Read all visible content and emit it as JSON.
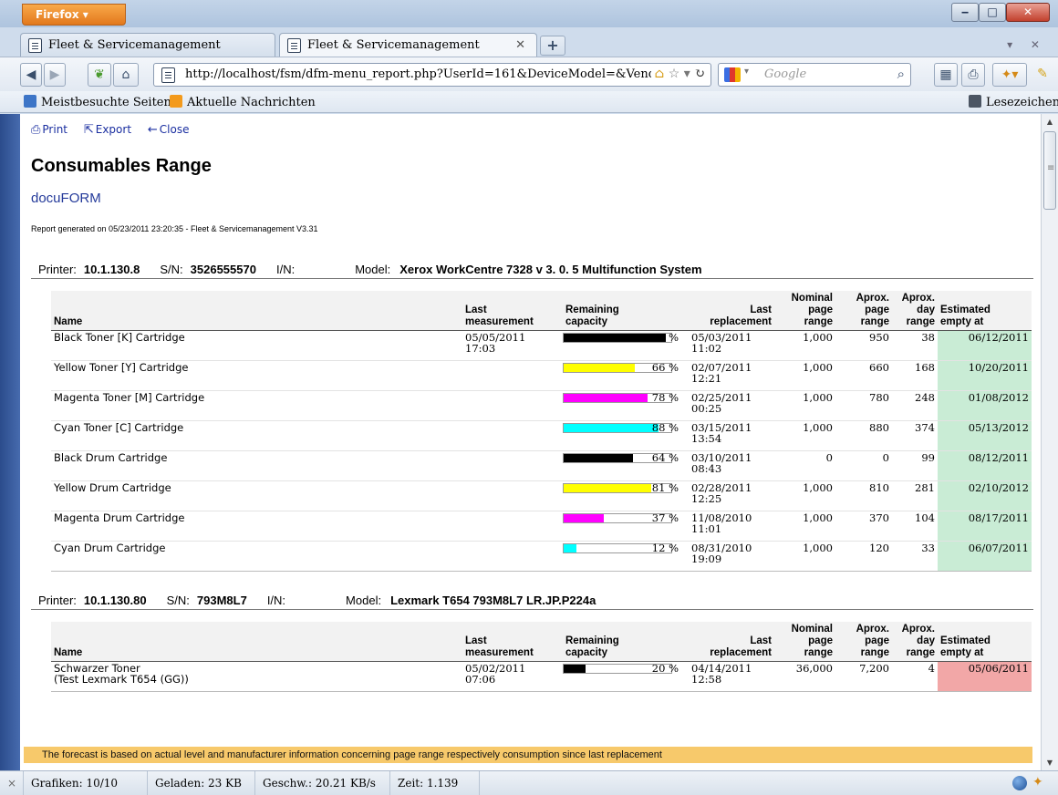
{
  "browser": {
    "app_button": "Firefox ▾",
    "tabs": [
      {
        "title": "Fleet & Servicemanagement"
      },
      {
        "title": "Fleet & Servicemanagement"
      }
    ],
    "url": "http://localhost/fsm/dfm-menu_report.php?UserId=161&DeviceModel=&Vendo",
    "search_placeholder": "Google",
    "bookmarks": [
      "Meistbesuchte Seiten",
      "Aktuelle Nachrichten"
    ],
    "bookmarks_right": "Lesezeichen"
  },
  "report": {
    "actions": {
      "print": "Print",
      "export": "Export",
      "close": "Close"
    },
    "title": "Consumables Range",
    "org": "docuFORM",
    "generated": "Report generated on 05/23/2011 23:20:35 - Fleet & Servicemanagement V3.31",
    "labels": {
      "printer": "Printer:",
      "sn": "S/N:",
      "in": "I/N:",
      "model": "Model:"
    },
    "columns": {
      "name": "Name",
      "last_measurement": [
        "Last",
        "measurement"
      ],
      "remaining": [
        "Remaining",
        "capacity"
      ],
      "last_replacement": [
        "Last",
        "replacement"
      ],
      "nominal": [
        "Nominal",
        "page",
        "range"
      ],
      "aprox_page": [
        "Aprox.",
        "page",
        "range"
      ],
      "aprox_day": [
        "Aprox.",
        "day",
        "range"
      ],
      "estimated": [
        "Estimated",
        "empty at"
      ]
    },
    "printers": [
      {
        "ip": "10.1.130.8",
        "sn": "3526555570",
        "in": "",
        "model": "Xerox WorkCentre 7328 v 3. 0. 5 Multifunction System",
        "items": [
          {
            "name": "Black Toner [K] Cartridge",
            "name2": "",
            "meas_date": "05/05/2011",
            "meas_time": "17:03",
            "pct": 95,
            "pct_label": "95 %",
            "color": "#000000",
            "rep_date": "05/03/2011",
            "rep_time": "11:02",
            "nominal": "1,000",
            "aprox_page": "950",
            "aprox_day": "38",
            "estimated": "06/12/2011",
            "est_bg": "#c9ecd5"
          },
          {
            "name": "Yellow Toner [Y] Cartridge",
            "name2": "",
            "meas_date": "",
            "meas_time": "",
            "pct": 66,
            "pct_label": "66 %",
            "color": "#ffff00",
            "rep_date": "02/07/2011",
            "rep_time": "12:21",
            "nominal": "1,000",
            "aprox_page": "660",
            "aprox_day": "168",
            "estimated": "10/20/2011",
            "est_bg": "#c9ecd5"
          },
          {
            "name": "Magenta Toner [M] Cartridge",
            "name2": "",
            "meas_date": "",
            "meas_time": "",
            "pct": 78,
            "pct_label": "78 %",
            "color": "#ff00ff",
            "rep_date": "02/25/2011",
            "rep_time": "00:25",
            "nominal": "1,000",
            "aprox_page": "780",
            "aprox_day": "248",
            "estimated": "01/08/2012",
            "est_bg": "#c9ecd5"
          },
          {
            "name": "Cyan Toner [C] Cartridge",
            "name2": "",
            "meas_date": "",
            "meas_time": "",
            "pct": 88,
            "pct_label": "88 %",
            "color": "#00ffff",
            "rep_date": "03/15/2011",
            "rep_time": "13:54",
            "nominal": "1,000",
            "aprox_page": "880",
            "aprox_day": "374",
            "estimated": "05/13/2012",
            "est_bg": "#c9ecd5"
          },
          {
            "name": "Black Drum Cartridge",
            "name2": "",
            "meas_date": "",
            "meas_time": "",
            "pct": 64,
            "pct_label": "64 %",
            "color": "#000000",
            "rep_date": "03/10/2011",
            "rep_time": "08:43",
            "nominal": "0",
            "aprox_page": "0",
            "aprox_day": "99",
            "estimated": "08/12/2011",
            "est_bg": "#c9ecd5"
          },
          {
            "name": "Yellow Drum Cartridge",
            "name2": "",
            "meas_date": "",
            "meas_time": "",
            "pct": 81,
            "pct_label": "81 %",
            "color": "#ffff00",
            "rep_date": "02/28/2011",
            "rep_time": "12:25",
            "nominal": "1,000",
            "aprox_page": "810",
            "aprox_day": "281",
            "estimated": "02/10/2012",
            "est_bg": "#c9ecd5"
          },
          {
            "name": "Magenta Drum Cartridge",
            "name2": "",
            "meas_date": "",
            "meas_time": "",
            "pct": 37,
            "pct_label": "37 %",
            "color": "#ff00ff",
            "rep_date": "11/08/2010",
            "rep_time": "11:01",
            "nominal": "1,000",
            "aprox_page": "370",
            "aprox_day": "104",
            "estimated": "08/17/2011",
            "est_bg": "#c9ecd5"
          },
          {
            "name": "Cyan Drum Cartridge",
            "name2": "",
            "meas_date": "",
            "meas_time": "",
            "pct": 12,
            "pct_label": "12 %",
            "color": "#00ffff",
            "rep_date": "08/31/2010",
            "rep_time": "19:09",
            "nominal": "1,000",
            "aprox_page": "120",
            "aprox_day": "33",
            "estimated": "06/07/2011",
            "est_bg": "#c9ecd5"
          }
        ]
      },
      {
        "ip": "10.1.130.80",
        "sn": "793M8L7",
        "in": "",
        "model": "Lexmark T654 793M8L7 LR.JP.P224a",
        "items": [
          {
            "name": "Schwarzer Toner",
            "name2": "(Test Lexmark T654 (GG))",
            "meas_date": "05/02/2011",
            "meas_time": "07:06",
            "pct": 20,
            "pct_label": "20 %",
            "color": "#000000",
            "rep_date": "04/14/2011",
            "rep_time": "12:58",
            "nominal": "36,000",
            "aprox_page": "7,200",
            "aprox_day": "4",
            "estimated": "05/06/2011",
            "est_bg": "#f2a7a7"
          }
        ]
      }
    ],
    "footer": "The forecast is based on actual level and manufacturer information concerning page range respectively consumption since last replacement"
  },
  "statusbar": {
    "close": "×",
    "images": "Grafiken: 10/10",
    "loaded": "Geladen: 23 KB",
    "speed": "Geschw.: 20.21 KB/s",
    "time": "Zeit: 1.139"
  }
}
